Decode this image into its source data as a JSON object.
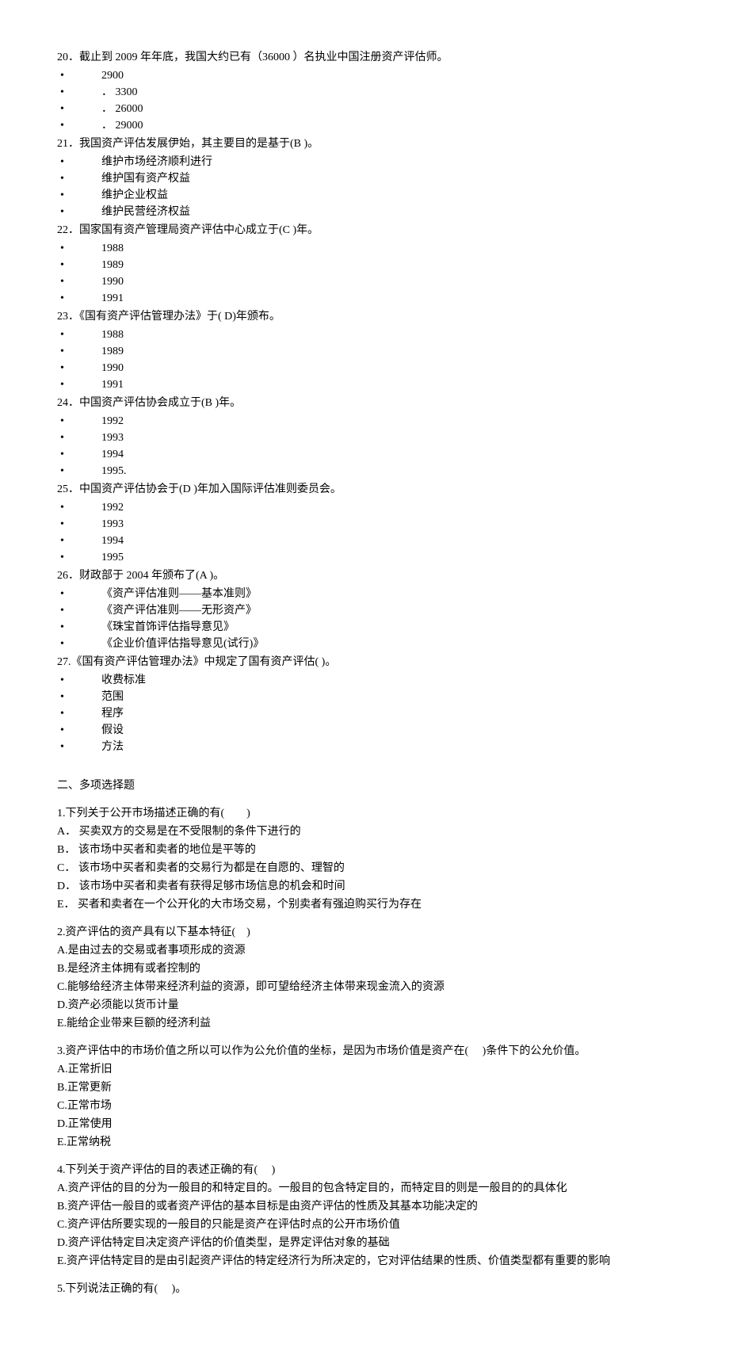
{
  "questions": [
    {
      "num": "20．",
      "text": "截止到 2009 年年底，我国大约已有（36000  ）名执业中国注册资产评估师。",
      "opts": [
        "2900",
        "． 3300",
        "． 26000",
        "． 29000"
      ]
    },
    {
      "num": "21．",
      "text": "我国资产评估发展伊始，其主要目的是基于(B )。",
      "opts": [
        "维护市场经济顺利进行",
        "维护国有资产权益",
        "维护企业权益",
        "维护民营经济权益"
      ]
    },
    {
      "num": "22．",
      "text": "国家国有资产管理局资产评估中心成立于(C )年。",
      "opts": [
        "1988",
        "1989",
        "1990",
        "1991"
      ]
    },
    {
      "num": "23．",
      "text": "《国有资产评估管理办法》于( D)年颁布。",
      "opts": [
        "1988",
        "1989",
        "1990",
        "1991"
      ]
    },
    {
      "num": "24．",
      "text": "中国资产评估协会成立于(B )年。",
      "opts": [
        "1992",
        "1993",
        "1994",
        "1995."
      ]
    },
    {
      "num": "25．",
      "text": "中国资产评估协会于(D )年加入国际评估准则委员会。",
      "opts": [
        "1992",
        "1993",
        "1994",
        "1995"
      ]
    },
    {
      "num": "26．",
      "text": "财政部于 2004 年颁布了(A )。",
      "opts": [
        "《资产评估准则——基本准则》",
        "《资产评估准则——无形资产》",
        "《珠宝首饰评估指导意见》",
        "《企业价值评估指导意见(试行)》"
      ]
    },
    {
      "num": "27.",
      "text": "《国有资产评估管理办法》中规定了国有资产评估( )。",
      "opts": [
        "收费标准",
        "范围",
        "程序",
        "假设",
        "方法"
      ]
    }
  ],
  "section2_title": "二、多项选择题",
  "mc": [
    {
      "q": "1.下列关于公开市场描述正确的有(　　)",
      "opts": [
        "A． 买卖双方的交易是在不受限制的条件下进行的",
        "B． 该市场中买者和卖者的地位是平等的",
        "C． 该市场中买者和卖者的交易行为都是在自愿的、理智的",
        "D． 该市场中买者和卖者有获得足够市场信息的机会和时间",
        "E． 买者和卖者在一个公开化的大市场交易，个别卖者有强迫购买行为存在"
      ]
    },
    {
      "q": "2.资产评估的资产具有以下基本特征(　)",
      "opts": [
        "A.是由过去的交易或者事项形成的资源",
        "B.是经济主体拥有或者控制的",
        "C.能够给经济主体带来经济利益的资源，即可望给经济主体带来现金流入的资源",
        "D.资产必须能以货币计量",
        "E.能给企业带来巨额的经济利益"
      ]
    },
    {
      "q": "3.资产评估中的市场价值之所以可以作为公允价值的坐标，是因为市场价值是资产在(　 )条件下的公允价值。",
      "opts": [
        "A.正常折旧",
        "B.正常更新",
        "C.正常市场",
        "D.正常使用",
        "E.正常纳税"
      ]
    },
    {
      "q": "4.下列关于资产评估的目的表述正确的有(　 )",
      "opts": [
        "A.资产评估的目的分为一般目的和特定目的。一般目的包含特定目的，而特定目的则是一般目的的具体化",
        "B.资产评估一般目的或者资产评估的基本目标是由资产评估的性质及其基本功能决定的",
        "C.资产评估所要实现的一般目的只能是资产在评估时点的公开市场价值",
        "D.资产评估特定目决定资产评估的价值类型，是界定评估对象的基础",
        "E.资产评估特定目的是由引起资产评估的特定经济行为所决定的，它对评估结果的性质、价值类型都有重要的影响"
      ]
    },
    {
      "q": "5.下列说法正确的有(　 )。",
      "opts": []
    }
  ]
}
